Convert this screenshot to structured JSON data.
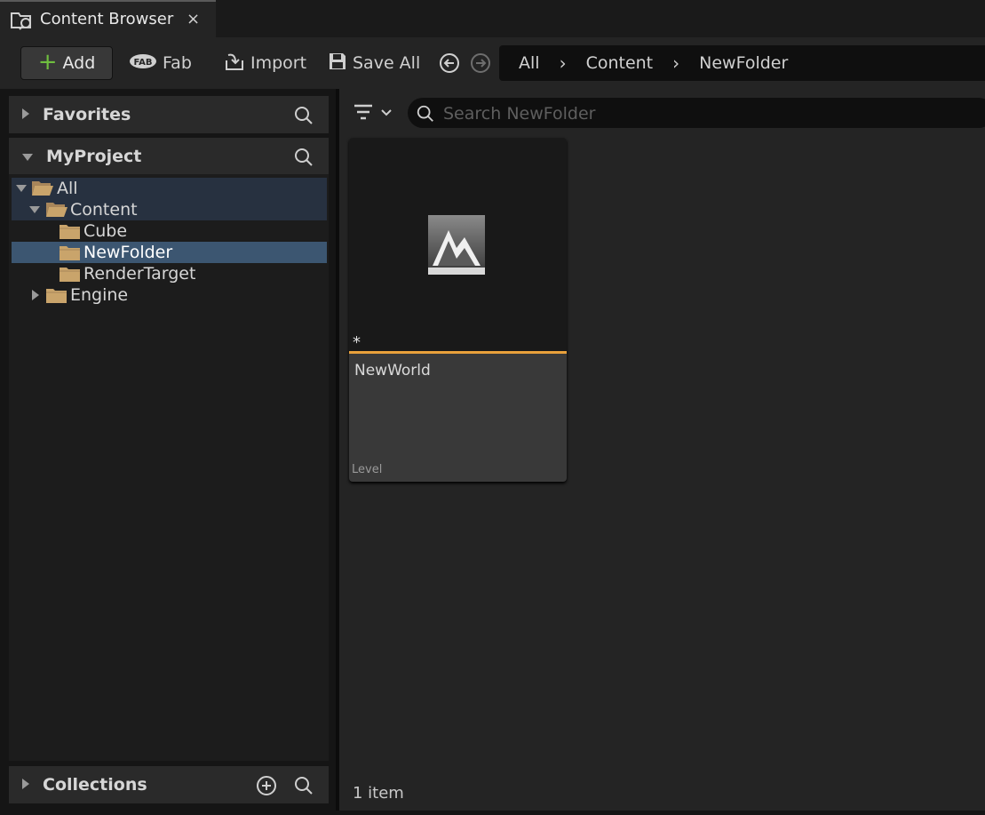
{
  "tab": {
    "title": "Content Browser",
    "close": "×"
  },
  "toolbar": {
    "add_label": "Add",
    "fab_label": "Fab",
    "import_label": "Import",
    "save_all_label": "Save All"
  },
  "breadcrumb": [
    "All",
    "Content",
    "NewFolder"
  ],
  "sidebar": {
    "favorites_label": "Favorites",
    "project_label": "MyProject",
    "collections_label": "Collections",
    "tree": [
      {
        "label": "All",
        "level": 0,
        "expanded": true
      },
      {
        "label": "Content",
        "level": 1,
        "expanded": true
      },
      {
        "label": "Cube",
        "level": 2
      },
      {
        "label": "NewFolder",
        "level": 2,
        "selected": true
      },
      {
        "label": "RenderTarget",
        "level": 2
      },
      {
        "label": "Engine",
        "level": 1,
        "expanded": false
      }
    ]
  },
  "search": {
    "placeholder": "Search NewFolder"
  },
  "assets": [
    {
      "name": "NewWorld",
      "type": "Level",
      "dirty_marker": "*"
    }
  ],
  "status": {
    "item_count": "1 item"
  },
  "colors": {
    "accent": "#e9a13b",
    "selection": "#3c5671",
    "add_plus": "#6fbf3f",
    "folder": "#c9a46b"
  }
}
